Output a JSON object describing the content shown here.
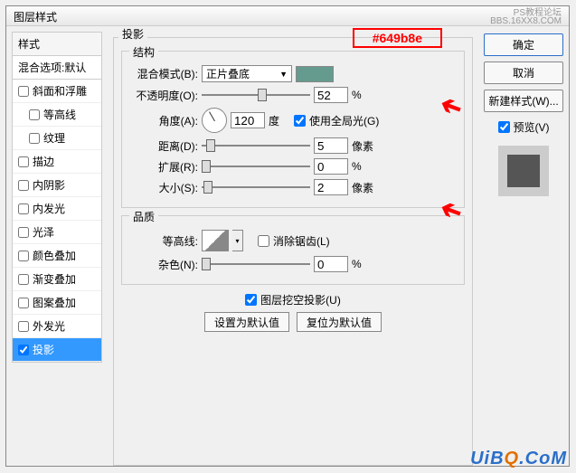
{
  "title": "图层样式",
  "watermark_top1": "PS教程论坛",
  "watermark_top2": "BBS.16XX8.COM",
  "styles": {
    "header": "样式",
    "blending": "混合选项:默认",
    "items": [
      {
        "label": "斜面和浮雕",
        "checked": false
      },
      {
        "label": "等高线",
        "checked": false,
        "indent": true
      },
      {
        "label": "纹理",
        "checked": false,
        "indent": true
      },
      {
        "label": "描边",
        "checked": false
      },
      {
        "label": "内阴影",
        "checked": false
      },
      {
        "label": "内发光",
        "checked": false
      },
      {
        "label": "光泽",
        "checked": false
      },
      {
        "label": "颜色叠加",
        "checked": false
      },
      {
        "label": "渐变叠加",
        "checked": false
      },
      {
        "label": "图案叠加",
        "checked": false
      },
      {
        "label": "外发光",
        "checked": false
      },
      {
        "label": "投影",
        "checked": true,
        "selected": true
      }
    ]
  },
  "panel": {
    "title": "投影",
    "annotation": "#649b8e",
    "structure": {
      "legend": "结构",
      "blend_mode_label": "混合模式(B):",
      "blend_mode_value": "正片叠底",
      "swatch_color": "#649b8e",
      "opacity_label": "不透明度(O):",
      "opacity_value": "52",
      "opacity_unit": "%",
      "angle_label": "角度(A):",
      "angle_value": "120",
      "angle_unit": "度",
      "global_light_label": "使用全局光(G)",
      "global_light_checked": true,
      "distance_label": "距离(D):",
      "distance_value": "5",
      "distance_unit": "像素",
      "spread_label": "扩展(R):",
      "spread_value": "0",
      "spread_unit": "%",
      "size_label": "大小(S):",
      "size_value": "2",
      "size_unit": "像素"
    },
    "quality": {
      "legend": "品质",
      "contour_label": "等高线:",
      "antialias_label": "消除锯齿(L)",
      "antialias_checked": false,
      "noise_label": "杂色(N):",
      "noise_value": "0",
      "noise_unit": "%"
    },
    "knockout_label": "图层挖空投影(U)",
    "knockout_checked": true,
    "make_default": "设置为默认值",
    "reset_default": "复位为默认值"
  },
  "right": {
    "ok": "确定",
    "cancel": "取消",
    "new_style": "新建样式(W)...",
    "preview_label": "预览(V)",
    "preview_checked": true
  },
  "bottom_watermark_pre": "UiB",
  "bottom_watermark_q": "Q",
  "bottom_watermark_post": ".CoM"
}
